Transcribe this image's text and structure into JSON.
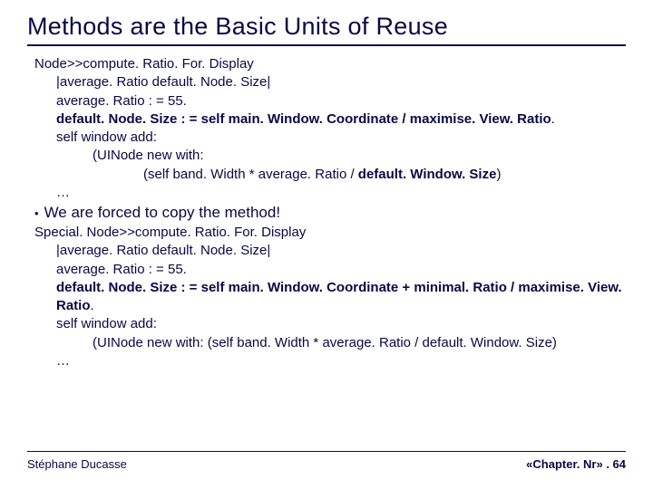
{
  "title": "Methods are the Basic Units of Reuse",
  "code1": {
    "l1": "Node>>compute. Ratio. For. Display",
    "l2": "|average. Ratio default. Node. Size|",
    "l3": "average. Ratio : = 55.",
    "l4a": "default. Node. Size : = self main. Window. Coordinate / maximise. View. Ratio",
    "l4b": ".",
    "l5": "self window add:",
    "l6": "(UINode new with:",
    "l7a": "(self band. Width * average. Ratio / ",
    "l7b": "default. Window. Size",
    "l7c": ")",
    "l8": "…"
  },
  "bullet": "We are forced to copy the method!",
  "code2": {
    "l1": "Special. Node>>compute. Ratio. For. Display",
    "l2": "|average. Ratio default. Node. Size|",
    "l3": "average. Ratio : = 55.",
    "l4a": "default. Node. Size : = self main. Window. Coordinate + minimal. Ratio / maximise. View. Ratio",
    "l4b": ".",
    "l5": "self window add:",
    "l6": "(UINode new with: (self band. Width * average. Ratio / default. Window. Size)",
    "l7": "…"
  },
  "footer": {
    "author": "Stéphane Ducasse",
    "chapter": "«Chapter. Nr» . 64"
  }
}
